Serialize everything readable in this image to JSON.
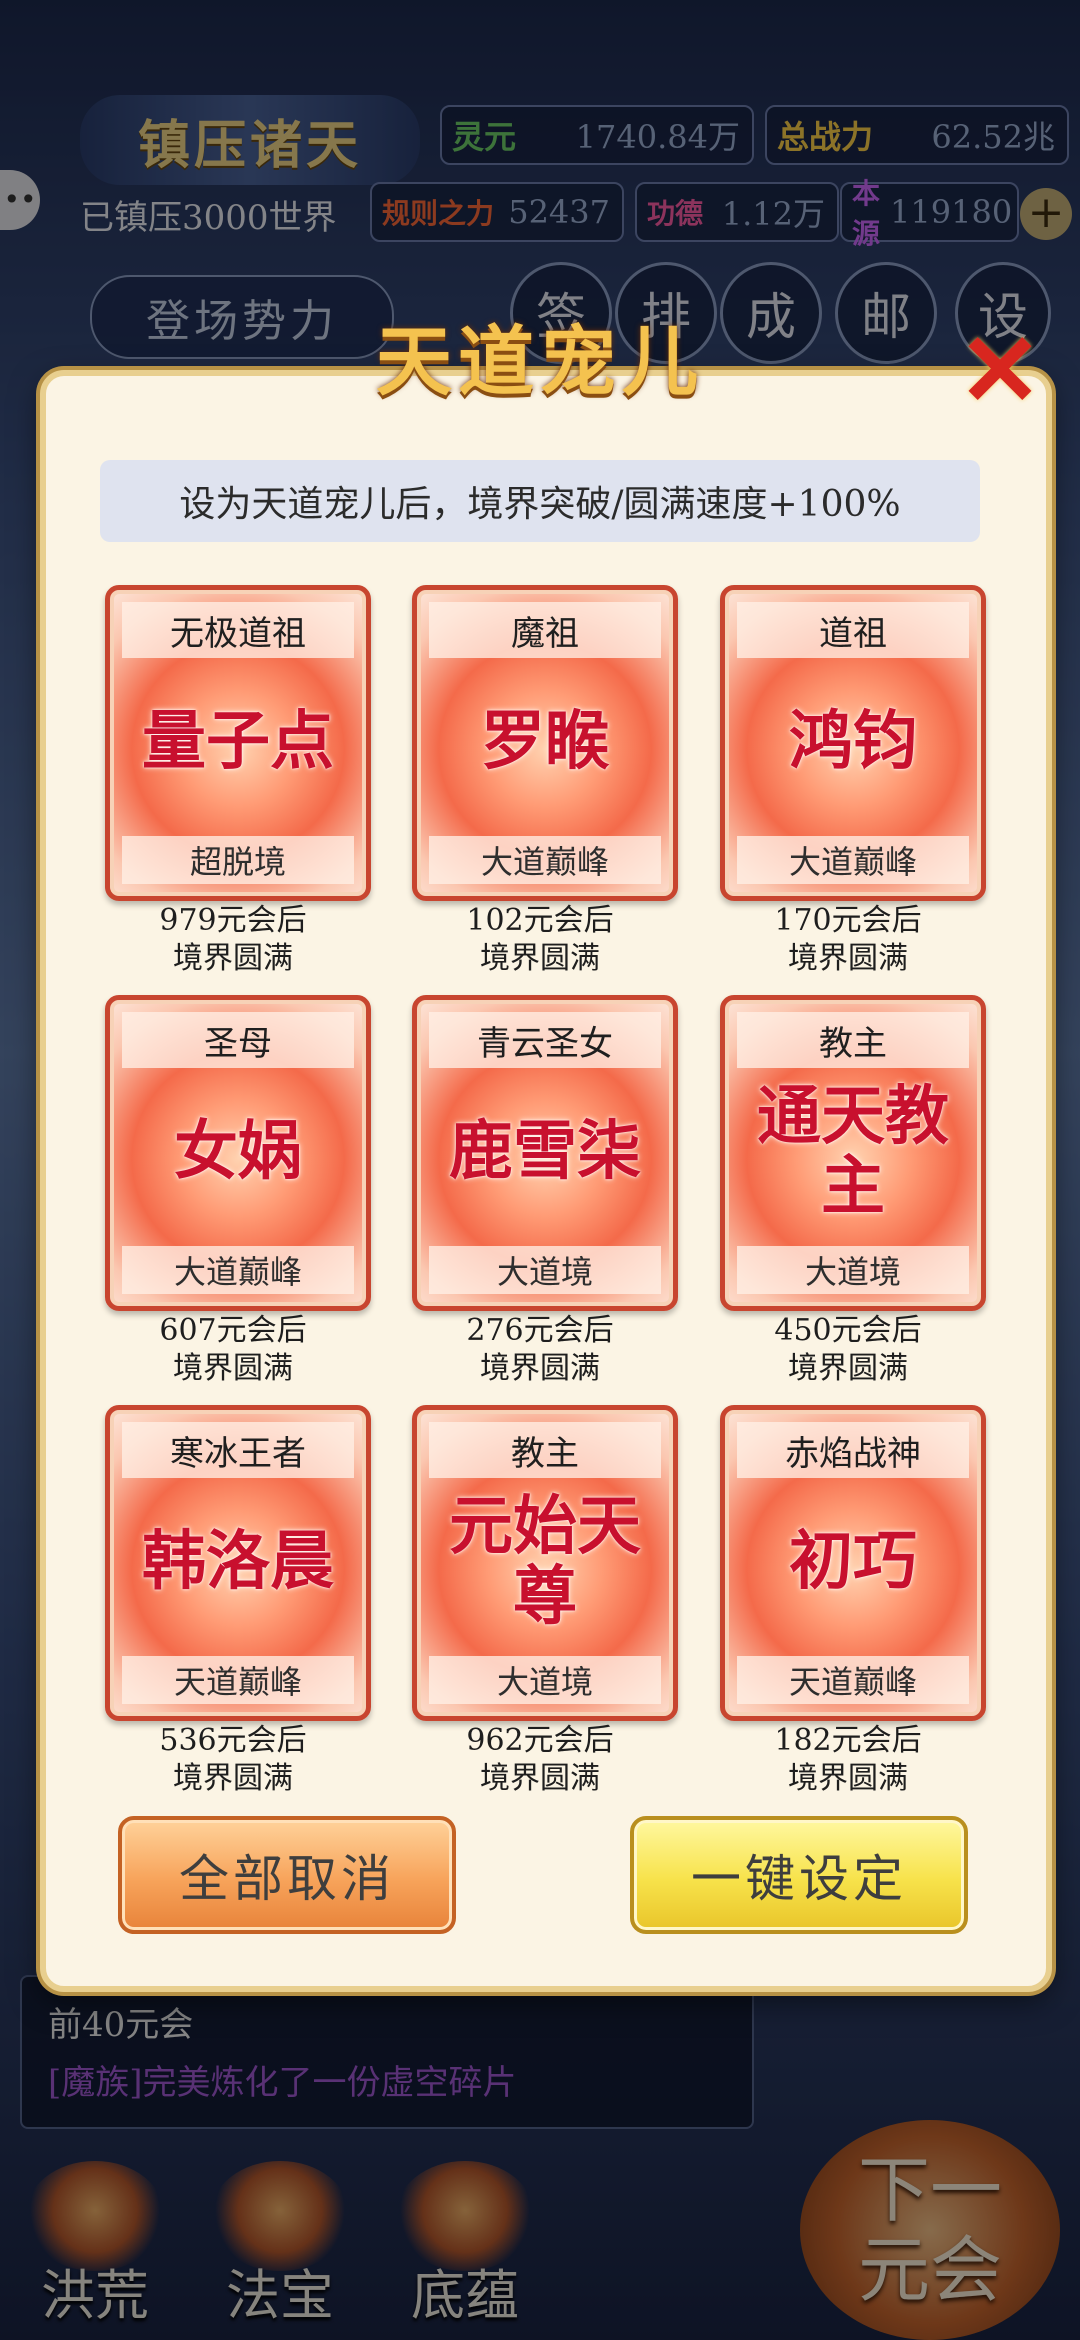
{
  "hud": {
    "title": "镇压诸天",
    "lingyuan_label": "灵元",
    "lingyuan_value": "1740.84万",
    "power_label": "总战力",
    "power_value": "62.52兆",
    "worlds_text": "已镇压3000世界",
    "rule_label": "规则之力",
    "rule_value": "52437",
    "third_label": "功德",
    "third_value": "1.12万",
    "source_label": "本源",
    "source_value": "119180",
    "plus": "+",
    "side_handle": "••",
    "debut_button": "登场势力",
    "circle_buttons": [
      "签",
      "排",
      "成",
      "邮",
      "设"
    ]
  },
  "modal": {
    "title": "天道宠儿",
    "close": "✕",
    "info": "设为天道宠儿后，境界突破/圆满速度+100%",
    "cards": [
      {
        "top": "无极道祖",
        "name": "量子点",
        "realm": "超脱境",
        "caption1": "979元会后",
        "caption2": "境界圆满"
      },
      {
        "top": "魔祖",
        "name": "罗睺",
        "realm": "大道巅峰",
        "caption1": "102元会后",
        "caption2": "境界圆满"
      },
      {
        "top": "道祖",
        "name": "鸿钧",
        "realm": "大道巅峰",
        "caption1": "170元会后",
        "caption2": "境界圆满"
      },
      {
        "top": "圣母",
        "name": "女娲",
        "realm": "大道巅峰",
        "caption1": "607元会后",
        "caption2": "境界圆满"
      },
      {
        "top": "青云圣女",
        "name": "鹿雪柒",
        "realm": "大道境",
        "caption1": "276元会后",
        "caption2": "境界圆满"
      },
      {
        "top": "教主",
        "name": "通天教主",
        "realm": "大道境",
        "caption1": "450元会后",
        "caption2": "境界圆满"
      },
      {
        "top": "寒冰王者",
        "name": "韩洛晨",
        "realm": "天道巅峰",
        "caption1": "536元会后",
        "caption2": "境界圆满"
      },
      {
        "top": "教主",
        "name": "元始天尊",
        "realm": "大道境",
        "caption1": "962元会后",
        "caption2": "境界圆满"
      },
      {
        "top": "赤焰战神",
        "name": "初巧",
        "realm": "天道巅峰",
        "caption1": "182元会后",
        "caption2": "境界圆满"
      }
    ],
    "cancel_all": "全部取消",
    "one_click_set": "一键设定"
  },
  "log": {
    "line1": "前40元会",
    "line2": "[魔族]完美炼化了一份虚空碎片"
  },
  "bottom_nav": {
    "items": [
      "洪荒",
      "法宝",
      "底蕴"
    ],
    "next_line1": "下一",
    "next_line2": "元会"
  },
  "colors": {
    "card_name": "#c8102e",
    "title_gold": "#f4c24f",
    "log_purple": "#a25ad6"
  }
}
